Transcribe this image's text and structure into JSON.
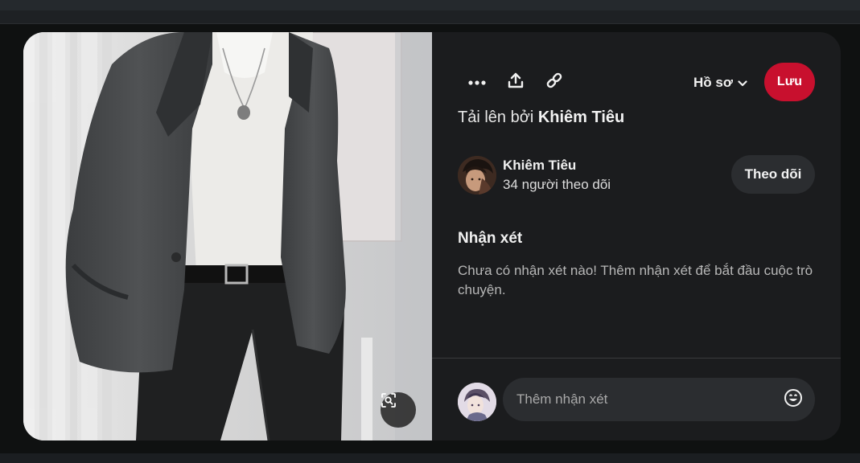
{
  "toolbar": {
    "more_icon": "ellipsis-icon",
    "share_icon": "share-upload-icon",
    "link_icon": "link-icon",
    "profile_label": "Hồ sơ",
    "save_label": "Lưu",
    "save_color": "#c8102e"
  },
  "pin": {
    "uploaded_prefix": "Tải lên bởi",
    "uploader": "Khiêm Tiêu",
    "lens_icon": "visual-search-icon"
  },
  "owner": {
    "name": "Khiêm Tiêu",
    "followers": "34 người theo dõi",
    "follow_label": "Theo dõi"
  },
  "comments": {
    "title": "Nhận xét",
    "empty_text": "Chưa có nhận xét nào! Thêm nhận xét để bắt đầu cuộc trò chuyện.",
    "placeholder": "Thêm nhận xét",
    "emoji_icon": "smiley-icon"
  }
}
